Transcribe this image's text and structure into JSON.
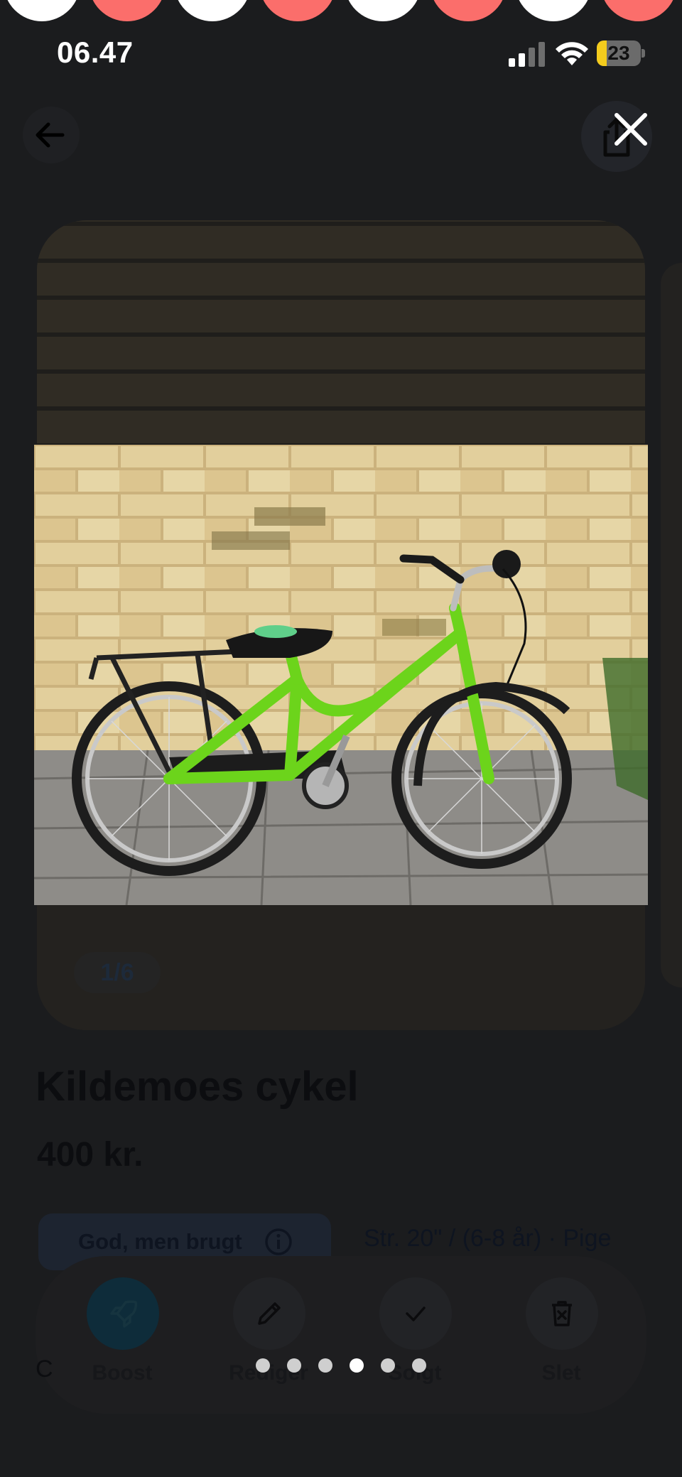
{
  "status_bar": {
    "time": "06.47",
    "battery": "23",
    "battery_level": 0.23
  },
  "listing": {
    "photo_counter": "1/6",
    "title": "Kildemoes cykel",
    "price": "400 kr.",
    "condition": "God, men brugt",
    "size": "Str. 20\" / (6-8 år) · Pige",
    "partial_text": "C"
  },
  "actions": {
    "boost": "Boost",
    "edit": "Rediger",
    "sold": "Solgt",
    "delete": "Slet"
  },
  "viewer": {
    "image_count": 6,
    "active_index": 3
  },
  "icons": {
    "back": "arrow-left-icon",
    "share": "share-icon",
    "close": "close-icon",
    "info": "info-icon",
    "boost": "rocket-icon",
    "edit": "pencil-icon",
    "sold": "checkmark-icon",
    "delete": "trash-icon"
  }
}
